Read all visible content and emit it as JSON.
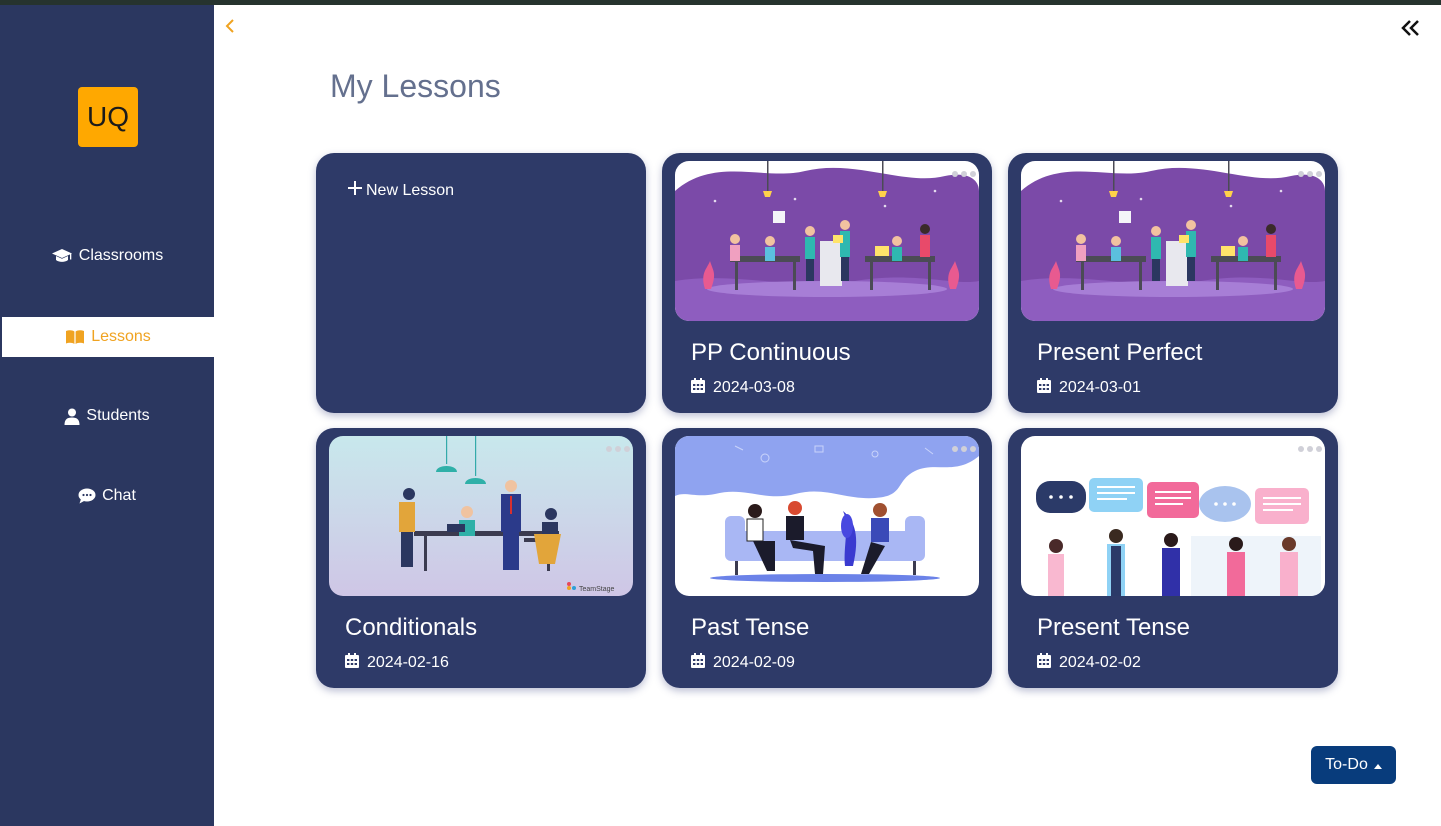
{
  "app": {
    "logo_text": "UQ"
  },
  "sidebar": {
    "items": [
      {
        "label": "Classrooms",
        "icon": "graduation-cap-icon",
        "active": false
      },
      {
        "label": "Lessons",
        "icon": "book-open-icon",
        "active": true
      },
      {
        "label": "Students",
        "icon": "user-icon",
        "active": false
      },
      {
        "label": "Chat",
        "icon": "chat-bubble-icon",
        "active": false
      }
    ]
  },
  "header": {
    "title": "My Lessons"
  },
  "new_lesson": {
    "label": "New Lesson",
    "icon": "plus-icon"
  },
  "lessons": [
    {
      "title": "PP Continuous",
      "date": "2024-03-08",
      "image": "office-team-illustration"
    },
    {
      "title": "Present Perfect",
      "date": "2024-03-01",
      "image": "office-team-illustration"
    },
    {
      "title": "Conditionals",
      "date": "2024-02-16",
      "image": "meeting-table-illustration",
      "image_caption": "TeamStage"
    },
    {
      "title": "Past Tense",
      "date": "2024-02-09",
      "image": "sofa-conversation-illustration"
    },
    {
      "title": "Present Tense",
      "date": "2024-02-02",
      "image": "speech-bubbles-illustration"
    }
  ],
  "todo": {
    "label": "To-Do"
  },
  "colors": {
    "sidebar": "#2b3760",
    "card": "#2e3a68",
    "accent": "#ffa800",
    "active_text": "#f0a321",
    "todo_button": "#083c7c",
    "title_text": "#64708e"
  }
}
